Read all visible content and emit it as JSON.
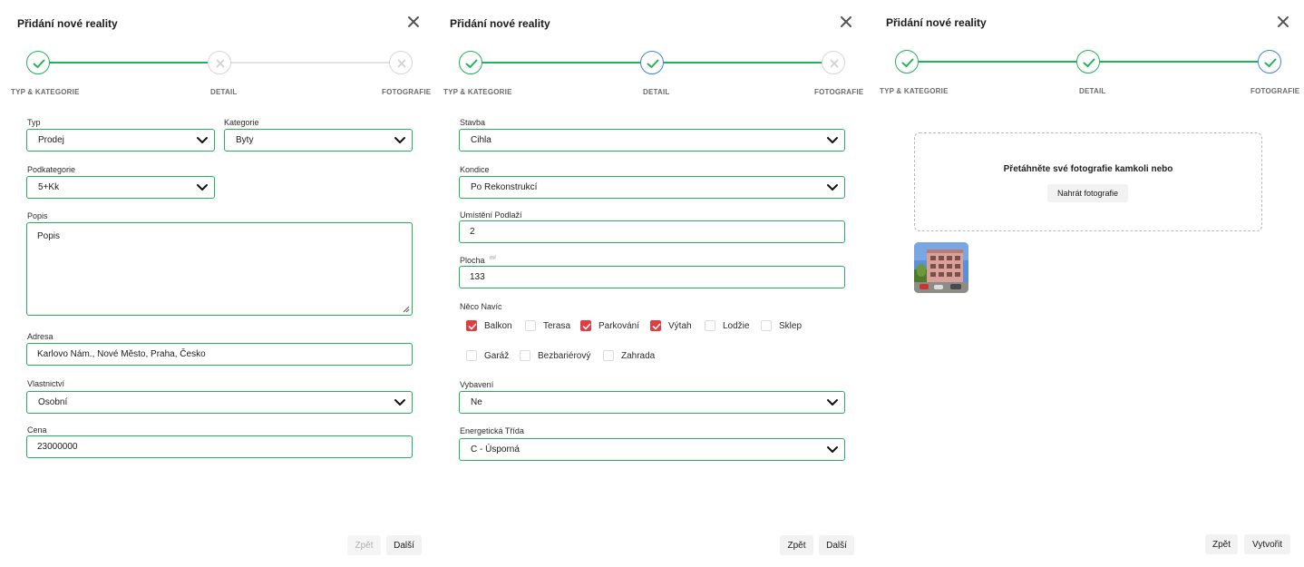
{
  "dialog_title": "Přidání nové reality",
  "steps": [
    "TYP & KATEGORIE",
    "DETAIL",
    "FOTOGRAFIE"
  ],
  "step1": {
    "typ": {
      "label": "Typ",
      "value": "Prodej"
    },
    "kategorie": {
      "label": "Kategorie",
      "value": "Byty"
    },
    "podkategorie": {
      "label": "Podkategorie",
      "value": "5+Kk"
    },
    "popis": {
      "label": "Popis",
      "value": "Popis"
    },
    "adresa": {
      "label": "Adresa",
      "value": "Karlovo Nám., Nové Město, Praha, Česko"
    },
    "vlastnictvi": {
      "label": "Vlastnictví",
      "value": "Osobní"
    },
    "cena": {
      "label": "Cena",
      "value": "23000000"
    },
    "back_label": "Zpět",
    "next_label": "Další"
  },
  "step2": {
    "stavba": {
      "label": "Stavba",
      "value": "Cihla"
    },
    "kondice": {
      "label": "Kondice",
      "value": "Po Rekonstrukcí"
    },
    "podlazi": {
      "label": "Umístění Podlaží",
      "value": "2"
    },
    "plocha": {
      "label": "Plocha",
      "unit": "m²",
      "value": "133"
    },
    "extras_label": "Něco Navíc",
    "extras": [
      {
        "label": "Balkon",
        "checked": true
      },
      {
        "label": "Terasa",
        "checked": false
      },
      {
        "label": "Parkování",
        "checked": true
      },
      {
        "label": "Výtah",
        "checked": true
      },
      {
        "label": "Lodžie",
        "checked": false
      },
      {
        "label": "Sklep",
        "checked": false
      },
      {
        "label": "Garáž",
        "checked": false
      },
      {
        "label": "Bezbariérový",
        "checked": false
      },
      {
        "label": "Zahrada",
        "checked": false
      }
    ],
    "vybaveni": {
      "label": "Vybavení",
      "value": "Ne"
    },
    "energeticka": {
      "label": "Energetická Třída",
      "value": "C - Úsporná"
    },
    "back_label": "Zpět",
    "next_label": "Další"
  },
  "step3": {
    "drop_text": "Přetáhněte své fotografie kamkoli nebo",
    "upload_label": "Nahrát fotografie",
    "back_label": "Zpět",
    "create_label": "Vytvořit"
  },
  "colors": {
    "success": "#22b35a",
    "current": "#3e84d9",
    "checked": "#e23b41"
  }
}
